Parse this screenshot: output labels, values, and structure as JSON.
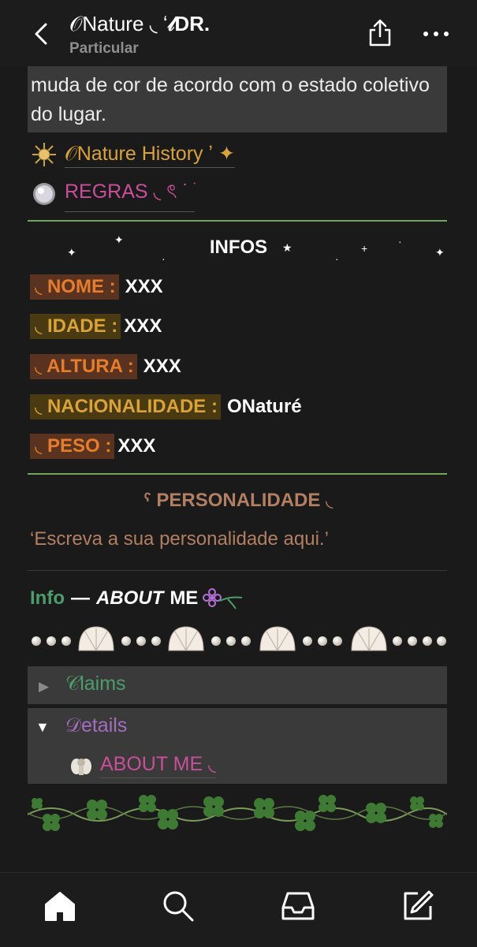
{
  "header": {
    "title_prefix": "𝒪Nature ◟ ʻ",
    "title_suffix": "𝓁DR.",
    "subtitle": "Particular"
  },
  "intro_text": "muda de cor de acordo com o estado coletivo do lugar.",
  "links": {
    "history": "𝒪Nature History ʼ ✦",
    "regras": "REGRAS ◟ ৎ ˙ ֹ"
  },
  "infos": {
    "title": "INFOS",
    "fields": [
      {
        "label": "◟ NOME :",
        "value": "XXX"
      },
      {
        "label": "◟ IDADE :",
        "value": "XXX"
      },
      {
        "label": "◟ ALTURA :",
        "value": "XXX"
      },
      {
        "label": "◟ NACIONALIDADE :",
        "value": "ONaturé"
      },
      {
        "label": "◟ PESO :",
        "value": "XXX"
      }
    ]
  },
  "personalidade": {
    "title": "ˁ PERSONALIDADE ◟",
    "text": "‘Escreva a sua personalidade aqui.’"
  },
  "about": {
    "info": "Info",
    "dash": "—",
    "about_italic": "ABOUT",
    "me": "ME"
  },
  "collapsibles": {
    "claims": "𝒞laims",
    "details": "𝒟etails",
    "details_link": "ABOUT ME ◟"
  },
  "colors": {
    "orange": "#e57d2b",
    "gold": "#d9a336",
    "pink": "#c94f9b",
    "green": "#4c9d6c",
    "purple": "#a56dc0",
    "brown": "#b27f62"
  },
  "icons": [
    "back-icon",
    "share-icon",
    "more-icon",
    "sun-icon",
    "pearl-icon",
    "flower-icon",
    "home-icon",
    "search-icon",
    "inbox-icon",
    "compose-icon"
  ]
}
